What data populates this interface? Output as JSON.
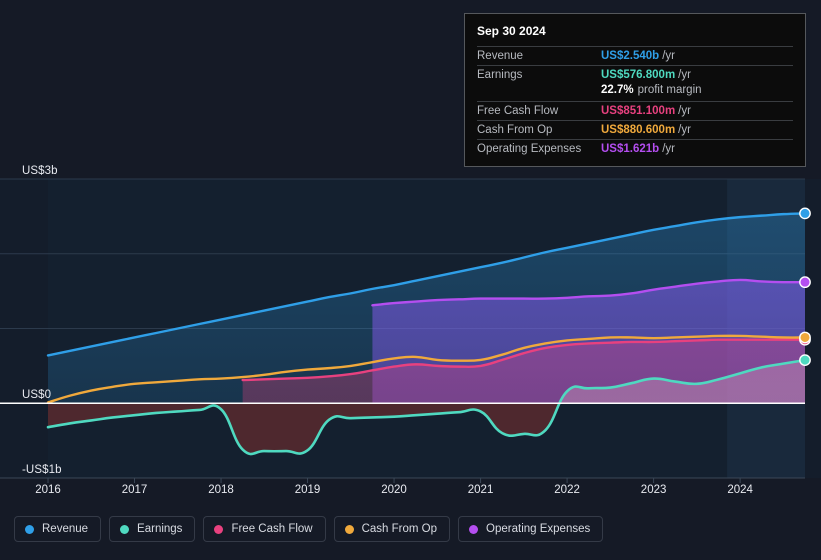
{
  "tooltip": {
    "date": "Sep 30 2024",
    "rows": [
      {
        "label": "Revenue",
        "value": "US$2.540b",
        "unit": "/yr",
        "color": "#2f9fe8"
      },
      {
        "label": "Earnings",
        "value": "US$576.800m",
        "unit": "/yr",
        "color": "#4fd9c0"
      },
      {
        "label": "",
        "value": "22.7%",
        "unit": "",
        "sub": "profit margin",
        "color": "#ffffff",
        "margin_row": true
      },
      {
        "label": "Free Cash Flow",
        "value": "US$851.100m",
        "unit": "/yr",
        "color": "#e8417f"
      },
      {
        "label": "Cash From Op",
        "value": "US$880.600m",
        "unit": "/yr",
        "color": "#f0a93c"
      },
      {
        "label": "Operating Expenses",
        "value": "US$1.621b",
        "unit": "/yr",
        "color": "#b44ef0"
      }
    ]
  },
  "legend": {
    "items": [
      {
        "label": "Revenue",
        "color": "#2f9fe8"
      },
      {
        "label": "Earnings",
        "color": "#4fd9c0"
      },
      {
        "label": "Free Cash Flow",
        "color": "#e8417f"
      },
      {
        "label": "Cash From Op",
        "color": "#f0a93c"
      },
      {
        "label": "Operating Expenses",
        "color": "#b44ef0"
      }
    ]
  },
  "chart_data": {
    "type": "area",
    "title": "",
    "xlabel": "",
    "ylabel": "",
    "ylim": [
      -1,
      3
    ],
    "yticks": [
      3,
      0,
      -1
    ],
    "ytick_labels": [
      "US$3b",
      "US$0",
      "-US$1b"
    ],
    "gridlines": [
      3,
      2,
      1,
      0,
      -1
    ],
    "grid": true,
    "legend_position": "bottom",
    "x": [
      2016.0,
      2016.25,
      2016.5,
      2016.75,
      2017.0,
      2017.25,
      2017.5,
      2017.75,
      2018.0,
      2018.25,
      2018.5,
      2018.75,
      2019.0,
      2019.25,
      2019.5,
      2019.75,
      2020.0,
      2020.25,
      2020.5,
      2020.75,
      2021.0,
      2021.25,
      2021.5,
      2021.75,
      2022.0,
      2022.25,
      2022.5,
      2022.75,
      2023.0,
      2023.25,
      2023.5,
      2023.75,
      2024.0,
      2024.25,
      2024.5,
      2024.75
    ],
    "xtick_labels": [
      "2016",
      "2017",
      "2018",
      "2019",
      "2020",
      "2021",
      "2022",
      "2023",
      "2024"
    ],
    "xticks": [
      2016,
      2017,
      2018,
      2019,
      2020,
      2021,
      2022,
      2023,
      2024
    ],
    "highlight_band": {
      "from": 2023.85,
      "to": 2024.75,
      "label": ""
    },
    "series": [
      {
        "name": "Revenue",
        "color": "#2f9fe8",
        "values": [
          0.64,
          0.7,
          0.76,
          0.82,
          0.88,
          0.94,
          1.0,
          1.06,
          1.12,
          1.18,
          1.24,
          1.3,
          1.36,
          1.42,
          1.47,
          1.53,
          1.58,
          1.64,
          1.7,
          1.76,
          1.82,
          1.88,
          1.95,
          2.02,
          2.08,
          2.14,
          2.2,
          2.26,
          2.32,
          2.37,
          2.42,
          2.46,
          2.49,
          2.51,
          2.53,
          2.54
        ]
      },
      {
        "name": "Operating Expenses",
        "color": "#b44ef0",
        "values": [
          null,
          null,
          null,
          null,
          null,
          null,
          null,
          null,
          null,
          null,
          null,
          null,
          null,
          null,
          null,
          1.31,
          1.34,
          1.36,
          1.38,
          1.39,
          1.4,
          1.4,
          1.4,
          1.4,
          1.41,
          1.43,
          1.44,
          1.47,
          1.52,
          1.56,
          1.6,
          1.63,
          1.65,
          1.63,
          1.62,
          1.62
        ]
      },
      {
        "name": "Cash From Op",
        "color": "#f0a93c",
        "values": [
          0.01,
          0.1,
          0.17,
          0.22,
          0.26,
          0.28,
          0.3,
          0.32,
          0.33,
          0.35,
          0.38,
          0.42,
          0.45,
          0.47,
          0.5,
          0.55,
          0.6,
          0.62,
          0.58,
          0.57,
          0.58,
          0.65,
          0.74,
          0.8,
          0.84,
          0.86,
          0.88,
          0.88,
          0.87,
          0.88,
          0.89,
          0.9,
          0.9,
          0.89,
          0.88,
          0.88
        ]
      },
      {
        "name": "Free Cash Flow",
        "color": "#e8417f",
        "values": [
          null,
          null,
          null,
          null,
          null,
          null,
          null,
          null,
          null,
          0.31,
          0.32,
          0.33,
          0.34,
          0.36,
          0.39,
          0.44,
          0.49,
          0.52,
          0.5,
          0.49,
          0.5,
          0.58,
          0.67,
          0.74,
          0.78,
          0.8,
          0.81,
          0.82,
          0.82,
          0.83,
          0.84,
          0.85,
          0.85,
          0.85,
          0.85,
          0.85
        ]
      },
      {
        "name": "Earnings",
        "color": "#4fd9c0",
        "values": [
          -0.32,
          -0.27,
          -0.23,
          -0.19,
          -0.16,
          -0.13,
          -0.11,
          -0.09,
          -0.08,
          -0.62,
          -0.64,
          -0.64,
          -0.63,
          -0.22,
          -0.2,
          -0.19,
          -0.18,
          -0.16,
          -0.14,
          -0.12,
          -0.11,
          -0.4,
          -0.41,
          -0.36,
          0.16,
          0.2,
          0.21,
          0.27,
          0.33,
          0.29,
          0.26,
          0.32,
          0.4,
          0.48,
          0.53,
          0.577
        ]
      }
    ]
  }
}
